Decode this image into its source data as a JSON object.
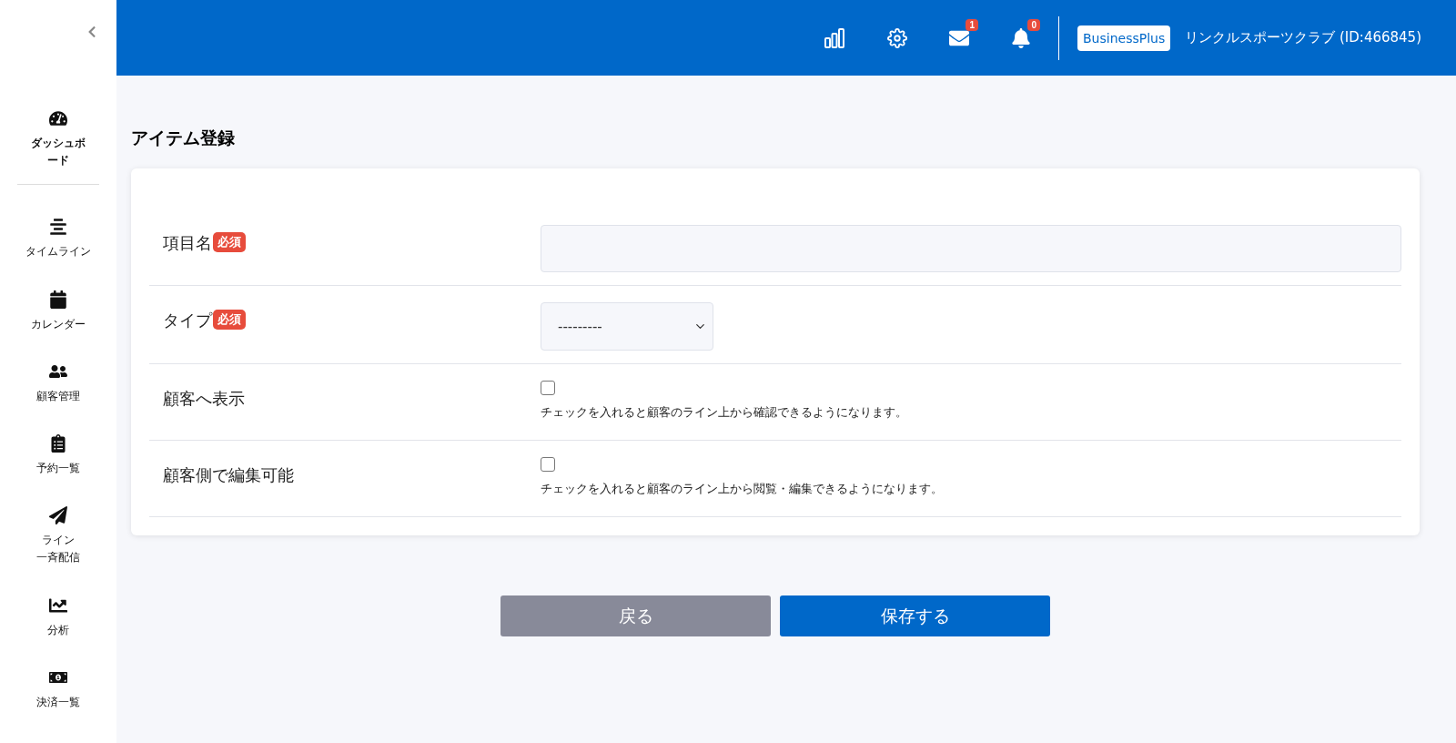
{
  "sidebar": {
    "items": [
      {
        "lines": [
          "ダッシュボード"
        ],
        "selected": true
      },
      {
        "lines": [
          "タイムライン"
        ],
        "selected": false
      },
      {
        "lines": [
          "カレンダー"
        ],
        "selected": false
      },
      {
        "lines": [
          "顧客管理"
        ],
        "selected": false
      },
      {
        "lines": [
          "予約一覧"
        ],
        "selected": false
      },
      {
        "lines": [
          "ライン",
          "一斉配信"
        ],
        "selected": false
      },
      {
        "lines": [
          "分析"
        ],
        "selected": false
      },
      {
        "lines": [
          "決済一覧"
        ],
        "selected": false
      }
    ]
  },
  "header": {
    "mail_count": "1",
    "notification_count": "0",
    "plan": "BusinessPlus",
    "account": "リンクルスポーツクラブ (ID:466845)"
  },
  "page_title": "アイテム登録",
  "form": {
    "rows": [
      {
        "kind": "text",
        "label": "項目名",
        "badge": "必須",
        "value": ""
      },
      {
        "kind": "select",
        "label": "タイプ",
        "badge": "必須",
        "value": "---------"
      },
      {
        "kind": "checkbox",
        "label": "顧客へ表示",
        "checked": false,
        "help": "チェックを入れると顧客のライン上から確認できるようになります。"
      },
      {
        "kind": "checkbox",
        "label": "顧客側で編集可能",
        "checked": false,
        "help": "チェックを入れると顧客のライン上から閲覧・編集できるようになります。"
      }
    ]
  },
  "buttons": {
    "back": "戻る",
    "save": "保存する"
  }
}
